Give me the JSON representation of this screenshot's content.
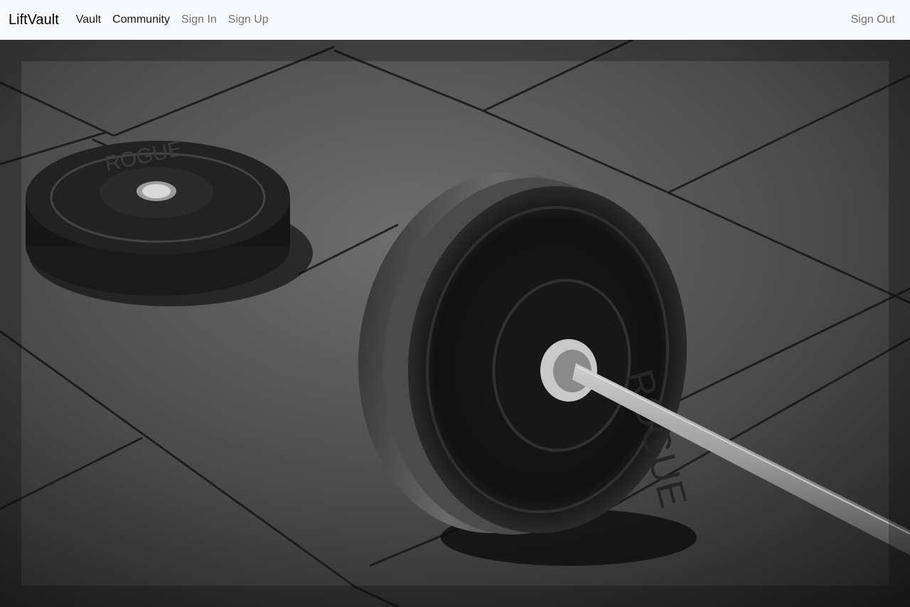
{
  "navbar": {
    "brand": "LiftVault",
    "links": [
      {
        "label": "Vault"
      },
      {
        "label": "Community"
      },
      {
        "label": "Sign In"
      },
      {
        "label": "Sign Up"
      }
    ],
    "right_link": "Sign Out"
  },
  "colors": {
    "navbar_bg": "#f8f9fa",
    "active_link": "rgba(0,0,0,0.9)",
    "muted_link": "rgba(0,0,0,0.55)"
  },
  "hero": {
    "subject": "black-and-white photo of a barbell with bumper plates on a rubber gym floor",
    "plate_branding": "ROGUE"
  }
}
